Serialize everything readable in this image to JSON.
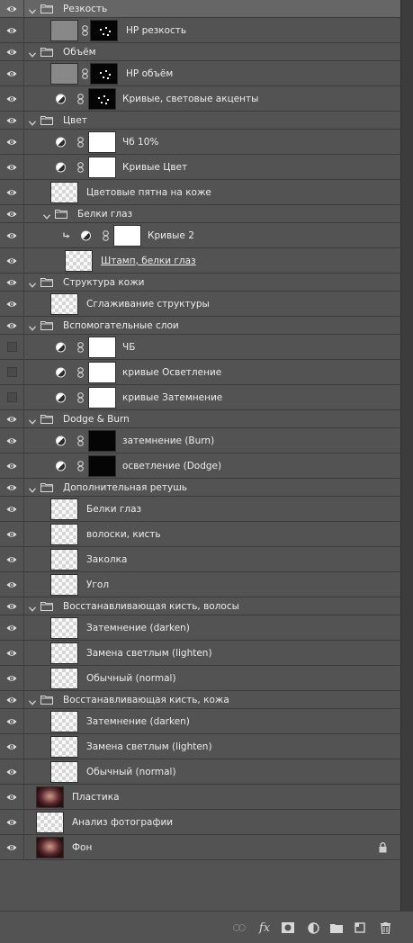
{
  "layers": [
    {
      "name": "Резкость",
      "type": "group",
      "level": 0,
      "visible": true,
      "selected": true
    },
    {
      "name": "HP резкость",
      "type": "pixel-mask",
      "level": 1,
      "visible": true,
      "thumb": "gray",
      "mask": "black-spots"
    },
    {
      "name": "Объём",
      "type": "group",
      "level": 0,
      "visible": true
    },
    {
      "name": "HP объём",
      "type": "pixel-mask",
      "level": 1,
      "visible": true,
      "thumb": "gray",
      "mask": "black-spots"
    },
    {
      "name": "Кривые, световые акценты",
      "type": "adjust",
      "level": 1,
      "visible": true,
      "mask": "black-spots"
    },
    {
      "name": "Цвет",
      "type": "group",
      "level": 0,
      "visible": true
    },
    {
      "name": "Чб 10%",
      "type": "adjust",
      "level": 1,
      "visible": true,
      "mask": "white"
    },
    {
      "name": "Кривые Цвет",
      "type": "adjust",
      "level": 1,
      "visible": true,
      "mask": "white"
    },
    {
      "name": "Цветовые пятна на коже",
      "type": "pixel",
      "level": 1,
      "visible": true,
      "thumb": "check"
    },
    {
      "name": "Белки глаз",
      "type": "group",
      "level": 1,
      "visible": true
    },
    {
      "name": "Кривые 2",
      "type": "adjust",
      "level": 2,
      "visible": true,
      "mask": "white",
      "clipped": true
    },
    {
      "name": "Штамп, белки глаз",
      "type": "pixel",
      "level": 2,
      "visible": true,
      "thumb": "check",
      "underline": true
    },
    {
      "name": "Структура кожи",
      "type": "group",
      "level": 0,
      "visible": true
    },
    {
      "name": "Сглаживание структуры",
      "type": "pixel",
      "level": 1,
      "visible": true,
      "thumb": "check"
    },
    {
      "name": "Вспомогательные слои",
      "type": "group",
      "level": 0,
      "visible": true
    },
    {
      "name": "ЧБ",
      "type": "adjust",
      "level": 1,
      "visible": false,
      "mask": "white"
    },
    {
      "name": "кривые Осветление",
      "type": "adjust",
      "level": 1,
      "visible": false,
      "mask": "white"
    },
    {
      "name": "кривые Затемнение",
      "type": "adjust",
      "level": 1,
      "visible": false,
      "mask": "white"
    },
    {
      "name": "Dodge & Burn",
      "type": "group",
      "level": 0,
      "visible": true
    },
    {
      "name": "затемнение (Burn)",
      "type": "adjust",
      "level": 1,
      "visible": true,
      "mask": "black"
    },
    {
      "name": "осветление (Dodge)",
      "type": "adjust",
      "level": 1,
      "visible": true,
      "mask": "black"
    },
    {
      "name": "Дополнительная ретушь",
      "type": "group",
      "level": 0,
      "visible": true
    },
    {
      "name": "Белки глаз",
      "type": "pixel",
      "level": 1,
      "visible": true,
      "thumb": "check"
    },
    {
      "name": "волоски, кисть",
      "type": "pixel",
      "level": 1,
      "visible": true,
      "thumb": "check"
    },
    {
      "name": "Заколка",
      "type": "pixel",
      "level": 1,
      "visible": true,
      "thumb": "check"
    },
    {
      "name": "Угол",
      "type": "pixel",
      "level": 1,
      "visible": true,
      "thumb": "check"
    },
    {
      "name": "Восстанавливающая кисть, волосы",
      "type": "group",
      "level": 0,
      "visible": true
    },
    {
      "name": "Затемнение (darken)",
      "type": "pixel",
      "level": 1,
      "visible": true,
      "thumb": "check"
    },
    {
      "name": "Замена светлым (lighten)",
      "type": "pixel",
      "level": 1,
      "visible": true,
      "thumb": "check"
    },
    {
      "name": "Обычный (normal)",
      "type": "pixel",
      "level": 1,
      "visible": true,
      "thumb": "check"
    },
    {
      "name": "Восстанавливающая кисть, кожа",
      "type": "group",
      "level": 0,
      "visible": true
    },
    {
      "name": "Затемнение (darken)",
      "type": "pixel",
      "level": 1,
      "visible": true,
      "thumb": "check"
    },
    {
      "name": "Замена светлым (lighten)",
      "type": "pixel",
      "level": 1,
      "visible": true,
      "thumb": "check"
    },
    {
      "name": "Обычный (normal)",
      "type": "pixel",
      "level": 1,
      "visible": true,
      "thumb": "check"
    },
    {
      "name": "Пластика",
      "type": "pixel",
      "level": 0,
      "visible": true,
      "thumb": "photo"
    },
    {
      "name": "Анализ фотографии",
      "type": "pixel",
      "level": 0,
      "visible": true,
      "thumb": "check"
    },
    {
      "name": "Фон",
      "type": "pixel",
      "level": 0,
      "visible": true,
      "thumb": "photo",
      "locked": true
    }
  ],
  "footer": {
    "buttons": [
      "link-layers-icon",
      "fx-icon",
      "add-mask-icon",
      "adjustment-layer-icon",
      "new-group-icon",
      "new-layer-icon",
      "trash-icon"
    ],
    "fx_label": "fx"
  }
}
